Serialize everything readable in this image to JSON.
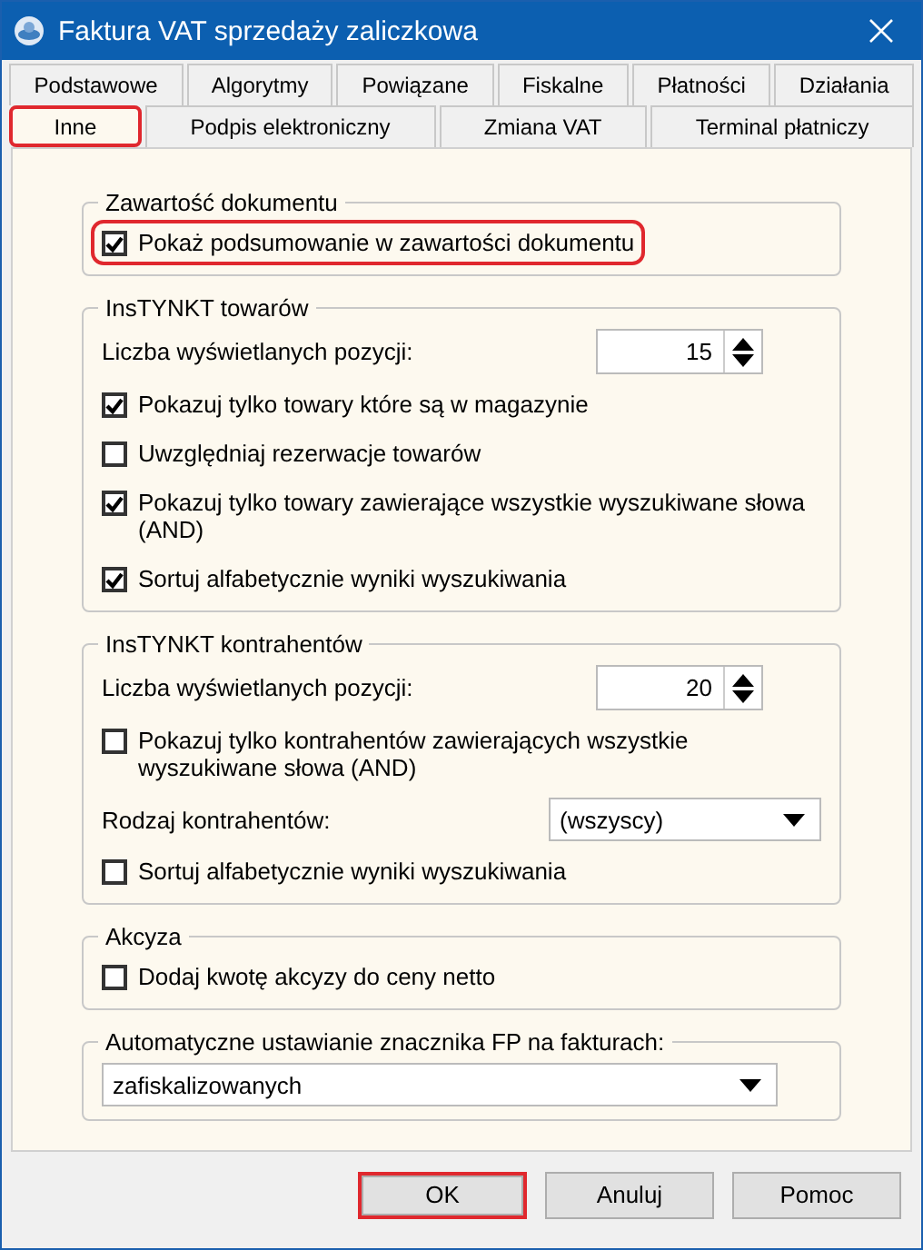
{
  "window": {
    "title": "Faktura VAT sprzedaży zaliczkowa"
  },
  "tab_rows": [
    [
      {
        "label": "Podstawowe",
        "selected": false,
        "highlighted": false
      },
      {
        "label": "Algorytmy",
        "selected": false,
        "highlighted": false
      },
      {
        "label": "Powiązane",
        "selected": false,
        "highlighted": false
      },
      {
        "label": "Fiskalne",
        "selected": false,
        "highlighted": false
      },
      {
        "label": "Płatności",
        "selected": false,
        "highlighted": false
      },
      {
        "label": "Działania",
        "selected": false,
        "highlighted": false
      }
    ],
    [
      {
        "label": "Inne",
        "selected": true,
        "highlighted": true
      },
      {
        "label": "Podpis elektroniczny",
        "selected": false,
        "highlighted": false
      },
      {
        "label": "Zmiana VAT",
        "selected": false,
        "highlighted": false
      },
      {
        "label": "Terminal płatniczy",
        "selected": false,
        "highlighted": false
      }
    ]
  ],
  "groups": [
    {
      "title": "Zawartość dokumentu",
      "items": [
        {
          "kind": "checkbox",
          "label": "Pokaż podsumowanie w zawartości dokumentu",
          "checked": true,
          "highlighted": true
        }
      ]
    },
    {
      "title": "InsTYNKT towarów",
      "items": [
        {
          "kind": "spin",
          "label": "Liczba wyświetlanych pozycji:",
          "value": "15"
        },
        {
          "kind": "checkbox",
          "label": "Pokazuj tylko towary które są w magazynie",
          "checked": true,
          "highlighted": false
        },
        {
          "kind": "checkbox",
          "label": "Uwzględniaj rezerwacje towarów",
          "checked": false,
          "highlighted": false
        },
        {
          "kind": "checkbox",
          "label": "Pokazuj tylko towary zawierające wszystkie wyszukiwane słowa (AND)",
          "checked": true,
          "highlighted": false
        },
        {
          "kind": "checkbox",
          "label": "Sortuj alfabetycznie wyniki wyszukiwania",
          "checked": true,
          "highlighted": false
        }
      ]
    },
    {
      "title": "InsTYNKT kontrahentów",
      "items": [
        {
          "kind": "spin",
          "label": "Liczba wyświetlanych pozycji:",
          "value": "20"
        },
        {
          "kind": "checkbox",
          "label": "Pokazuj tylko kontrahentów zawierających wszystkie wyszukiwane słowa (AND)",
          "checked": false,
          "highlighted": false
        },
        {
          "kind": "select",
          "label": "Rodzaj kontrahentów:",
          "value": "(wszyscy)"
        },
        {
          "kind": "checkbox",
          "label": "Sortuj alfabetycznie wyniki wyszukiwania",
          "checked": false,
          "highlighted": false
        }
      ]
    },
    {
      "title": "Akcyza",
      "items": [
        {
          "kind": "checkbox",
          "label": "Dodaj kwotę akcyzy do ceny netto",
          "checked": false,
          "highlighted": false
        }
      ]
    },
    {
      "title": "Automatyczne ustawianie znacznika FP na fakturach:",
      "items": [
        {
          "kind": "wide-select",
          "value": "zafiskalizowanych"
        }
      ]
    }
  ],
  "buttons": [
    {
      "label": "OK",
      "highlighted": true
    },
    {
      "label": "Anuluj",
      "highlighted": false
    },
    {
      "label": "Pomoc",
      "highlighted": false
    }
  ]
}
